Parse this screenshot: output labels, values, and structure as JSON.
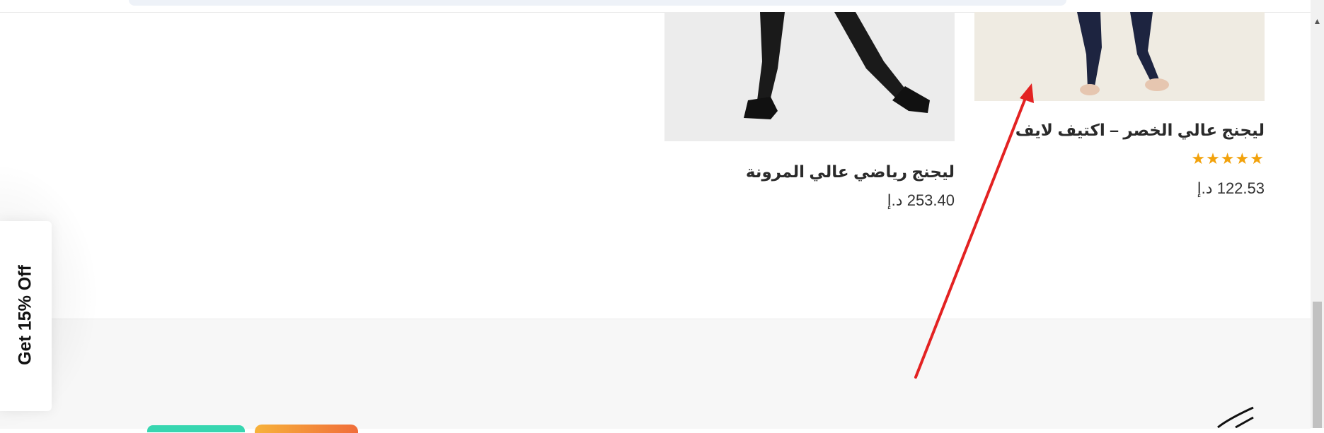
{
  "products": [
    {
      "title": "ليجنج عالي الخصر – اكتيف لايف",
      "rating_stars": 5,
      "price": "122.53 د.إ"
    },
    {
      "title": "ليجنج رياضي عالي المرونة",
      "price": "253.40 د.إ"
    }
  ],
  "popup": {
    "label": "Get 15% Off"
  },
  "colors": {
    "star": "#f2a20c",
    "annotation_arrow": "#e32222",
    "badge_teal": "#37d6b0",
    "badge_orange": "#f48a3a"
  },
  "icons": [
    "star-icon",
    "scroll-up-arrow-icon",
    "annotation-arrow-icon"
  ]
}
